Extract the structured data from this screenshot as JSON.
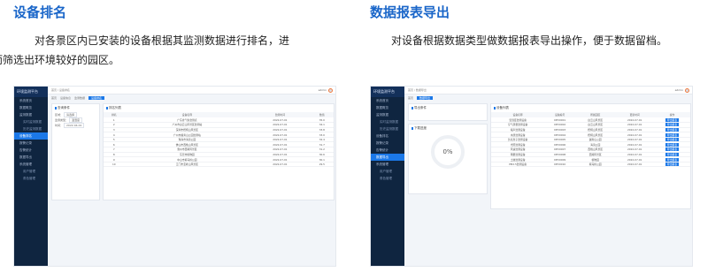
{
  "left": {
    "title": "设备排名",
    "desc_line1": "对各景区内已安装的设备根据其监测数据进行排名，进",
    "desc_line2": "而筛选出环境较好的园区。",
    "app_name": "环境监测平台",
    "breadcrumb": "首页 / 设备排名",
    "user": "admin",
    "tabs": [
      "首页",
      "设备信息",
      "监测数据",
      "设备排名"
    ],
    "menu": [
      "系统首页",
      "数据概览",
      "监测数据",
      "实时监测数据",
      "历史监测数据",
      "设备排名",
      "报警记录",
      "告警统计",
      "数据导出",
      "系统管理",
      "用户管理",
      "角色管理"
    ],
    "active_menu_index": 5,
    "filter_title": "查询条件",
    "filter_rows": [
      [
        "区域：",
        "请选择"
      ],
      [
        "监测类型：",
        "温湿度"
      ],
      [
        "时间：",
        "2022-04-01"
      ]
    ],
    "table_title": "排名列表",
    "columns": [
      "排名",
      "设备名称",
      "监测时间",
      "数值"
    ],
    "rows": [
      [
        "1",
        "广东省气象监测点",
        "2022-07-01",
        "35.0"
      ],
      [
        "2",
        "广州市白云山风景区监测站",
        "2022-07-01",
        "34.1"
      ],
      [
        "3",
        "深圳市梧桐山风景区",
        "2022-07-01",
        "33.8"
      ],
      [
        "4",
        "广州市越秀山公园监测站",
        "2022-07-01",
        "33.0"
      ],
      [
        "5",
        "珠海市海滨公园",
        "2022-07-01",
        "32.4"
      ],
      [
        "6",
        "佛山市西樵山风景区",
        "2022-07-01",
        "31.7"
      ],
      [
        "7",
        "惠州市西湖风景区",
        "2022-07-01",
        "31.2"
      ],
      [
        "8",
        "东莞市植物园",
        "2022-07-01",
        "30.6"
      ],
      [
        "9",
        "中山市紫马岭公园",
        "2022-07-01",
        "30.1"
      ],
      [
        "10",
        "江门市圭峰山风景区",
        "2022-07-01",
        "29.5"
      ]
    ]
  },
  "right": {
    "title": "数据报表导出",
    "desc_line1": "对设备根据数据类型做数据报表导出操作，便于数据留档。",
    "app_name": "环境监测平台",
    "breadcrumb": "首页 / 数据导出",
    "user": "admin",
    "tabs": [
      "首页",
      "数据导出"
    ],
    "menu": [
      "系统首页",
      "数据概览",
      "监测数据",
      "实时监测数据",
      "历史监测数据",
      "设备排名",
      "报警记录",
      "告警统计",
      "数据导出",
      "系统管理",
      "用户管理",
      "角色管理"
    ],
    "active_menu_index": 8,
    "filter_title": "导出条件",
    "progress_title": "下载进度",
    "progress_value": "0%",
    "table_title": "设备列表",
    "columns": [
      "设备名称",
      "设备编号",
      "所属园区",
      "更新时间",
      "操作"
    ],
    "rows": [
      [
        "温湿度监测设备",
        "DEV0001",
        "白云山风景区",
        "2022-07-01",
        "导出报表"
      ],
      [
        "空气质量监测设备",
        "DEV0002",
        "白云山风景区",
        "2022-07-01",
        "导出报表"
      ],
      [
        "噪声监测设备",
        "DEV0003",
        "梧桐山风景区",
        "2022-07-01",
        "导出报表"
      ],
      [
        "水质监测设备",
        "DEV0004",
        "梧桐山风景区",
        "2022-07-01",
        "导出报表"
      ],
      [
        "负氧离子监测设备",
        "DEV0005",
        "越秀山公园",
        "2022-07-01",
        "导出报表"
      ],
      [
        "光照监测设备",
        "DEV0006",
        "海滨公园",
        "2022-07-01",
        "导出报表"
      ],
      [
        "风速监测设备",
        "DEV0007",
        "西樵山风景区",
        "2022-07-01",
        "导出报表"
      ],
      [
        "雨量监测设备",
        "DEV0008",
        "西湖风景区",
        "2022-07-01",
        "导出报表"
      ],
      [
        "土壤监测设备",
        "DEV0009",
        "植物园",
        "2022-07-01",
        "导出报表"
      ],
      [
        "PM2.5监测设备",
        "DEV0010",
        "紫马岭公园",
        "2022-07-01",
        "导出报表"
      ]
    ]
  }
}
